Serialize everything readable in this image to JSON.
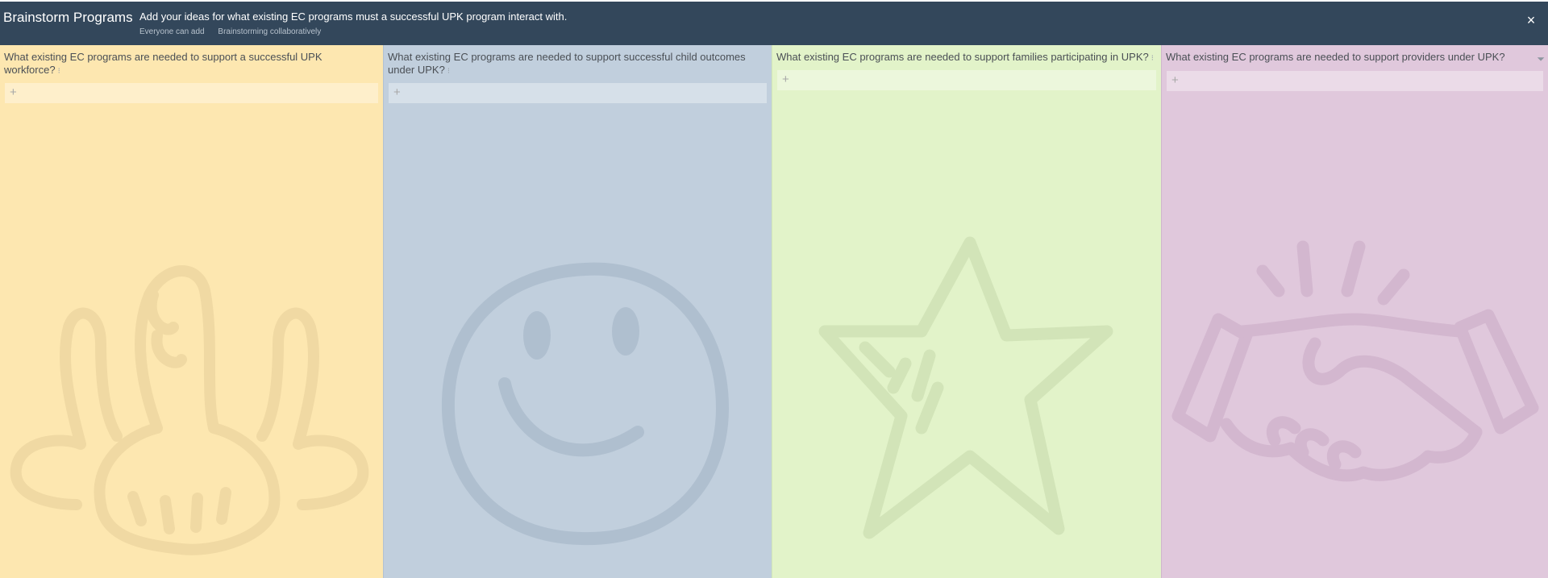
{
  "header": {
    "title": "Brainstorm Programs",
    "instructions": "Add your ideas for what existing EC programs must a successful UPK program interact with.",
    "meta": [
      "Everyone can add",
      "Brainstorming collaboratively"
    ],
    "close_icon": "×"
  },
  "columns": [
    {
      "title": "What existing EC programs are needed to support a successful UPK workforce?",
      "drag_icon": "⁝",
      "add_icon": "+",
      "background": "#fde7b0",
      "watermark": "hands-icon"
    },
    {
      "title": "What existing EC programs are needed to support successful child outcomes under UPK?",
      "drag_icon": "⁝",
      "add_icon": "+",
      "background": "#c1cfdd",
      "watermark": "smiley-icon"
    },
    {
      "title": "What existing EC programs are needed to support families participating in UPK?",
      "drag_icon": "⁝",
      "add_icon": "+",
      "background": "#e2f3c9",
      "watermark": "star-icon"
    },
    {
      "title": "What existing EC programs are needed to support providers under UPK?",
      "filter_icon": "⏷",
      "add_icon": "+",
      "background": "#e0c8dc",
      "watermark": "handshake-icon"
    }
  ],
  "colors": {
    "topbar": "#33475b"
  }
}
